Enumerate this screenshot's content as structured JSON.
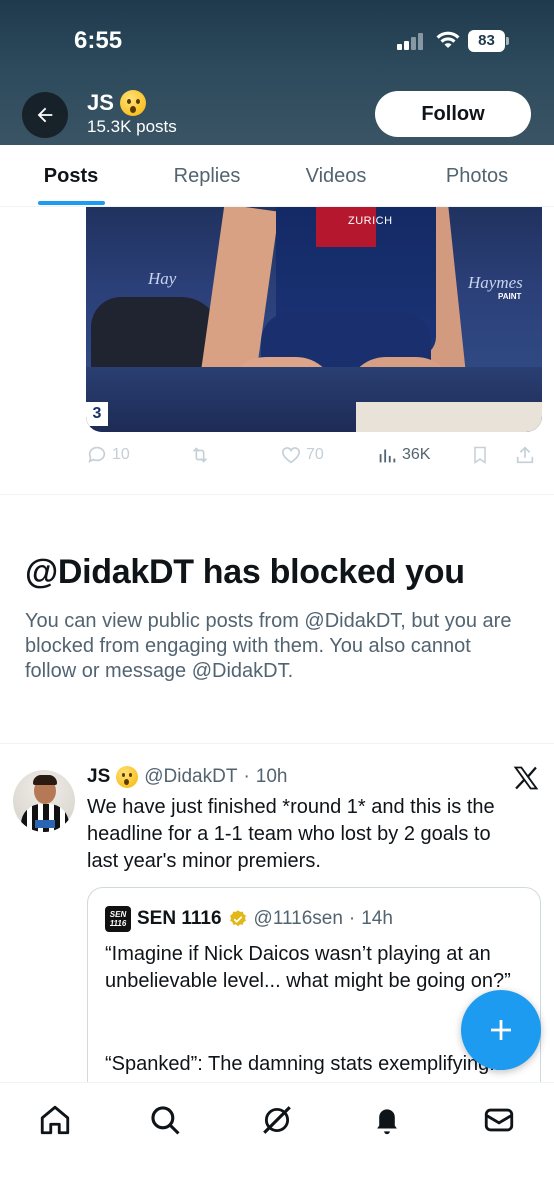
{
  "status_bar": {
    "time": "6:55",
    "battery": "83"
  },
  "header": {
    "name": "JS",
    "posts": "15.3K posts",
    "follow_label": "Follow"
  },
  "tabs": [
    {
      "label": "Posts",
      "active": true
    },
    {
      "label": "Replies",
      "active": false
    },
    {
      "label": "Videos",
      "active": false
    },
    {
      "label": "Photos",
      "active": false
    }
  ],
  "media_post": {
    "image_text": {
      "sponsor_left": "Hay",
      "sponsor_right": "Haymes",
      "paint": "PAINT",
      "jersey": "ZURICH",
      "number": "3"
    },
    "actions": {
      "replies": "10",
      "likes": "70",
      "views": "36K"
    }
  },
  "block_notice": {
    "title": "@DidakDT has blocked you",
    "body": "You can view public posts from @DidakDT, but you are blocked from engaging with them. You also cannot follow or message @DidakDT."
  },
  "tweet": {
    "name": "JS",
    "handle": "@DidakDT",
    "time": "10h",
    "text": "We have just finished *round 1* and this is the headline for a 1-1 team who lost by 2 goals to last year's minor premiers.",
    "quote": {
      "logo_text": "SEN 1116",
      "name": "SEN 1116",
      "handle": "@1116sen",
      "time": "14h",
      "text": "“Imagine if Nick Daicos wasn’t playing at an unbelievable level... what might be going on?”",
      "text2": "“Spanked”: The damning stats exemplifying..."
    }
  },
  "colors": {
    "accent": "#1d9bf0",
    "text": "#0f1419",
    "muted": "#536471",
    "verified": "#e2b719"
  },
  "icons": {
    "back": "arrow-left-icon",
    "reply": "reply-icon",
    "retweet": "retweet-icon",
    "like": "heart-icon",
    "views": "views-icon",
    "bookmark": "bookmark-icon",
    "share": "share-icon",
    "compose": "plus-icon",
    "nav": [
      "home-icon",
      "search-icon",
      "grok-icon",
      "notifications-icon",
      "messages-icon"
    ]
  }
}
